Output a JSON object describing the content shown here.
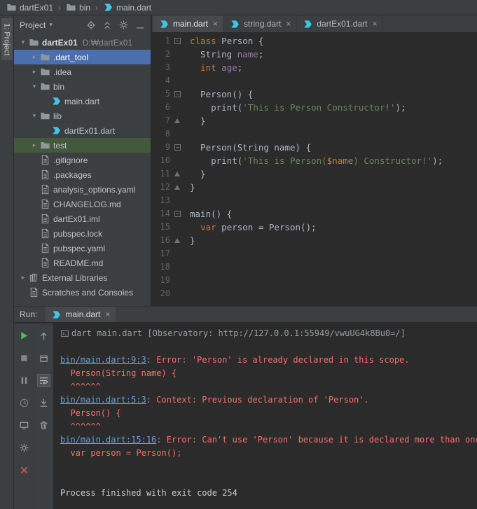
{
  "colors": {
    "background": "#2b2b2b",
    "panel": "#3c3f41",
    "selection_blue": "#4b6eaf",
    "test_row_green": "#44583c",
    "keyword_orange": "#cc7832",
    "string_green": "#6a8759",
    "field_purple": "#9876aa",
    "error_red": "#ff6b68",
    "link_blue": "#6a9fd8",
    "run_green": "#4ebe51",
    "close_red": "#c75450",
    "dart_teal": "#40c4e6"
  },
  "breadcrumb_bar": {
    "items": [
      {
        "label": "dartEx01",
        "glyph": "folder"
      },
      {
        "label": "bin",
        "glyph": "folder"
      },
      {
        "label": "main.dart",
        "glyph": "dart"
      }
    ]
  },
  "tool_strip": {
    "project_button_label": "1: Project"
  },
  "project_panel": {
    "title": "Project",
    "toolbar_icons": [
      {
        "id": "locate-file-icon",
        "glyph": "locate"
      },
      {
        "id": "collapse-all-icon",
        "glyph": "collapse"
      },
      {
        "id": "settings-gear-icon",
        "glyph": "gear"
      },
      {
        "id": "hide-panel-icon",
        "glyph": "hide"
      }
    ],
    "tree": [
      {
        "label": "dartEx01",
        "path": "D:₩dartEx01",
        "level": 0,
        "glyph": "folder",
        "chevron": "expanded",
        "bold": true
      },
      {
        "label": ".dart_tool",
        "level": 1,
        "glyph": "folder",
        "chevron": "collapsed",
        "selected": true
      },
      {
        "label": ".idea",
        "level": 1,
        "glyph": "folder",
        "chevron": "collapsed"
      },
      {
        "label": "bin",
        "level": 1,
        "glyph": "folder",
        "chevron": "expanded"
      },
      {
        "label": "main.dart",
        "level": 2,
        "glyph": "dart"
      },
      {
        "label": "lib",
        "level": 1,
        "glyph": "folder",
        "chevron": "expanded"
      },
      {
        "label": "dartEx01.dart",
        "level": 2,
        "glyph": "dart"
      },
      {
        "label": "test",
        "level": 1,
        "glyph": "folder",
        "chevron": "collapsed",
        "highlight": "test"
      },
      {
        "label": ".gitignore",
        "level": 1,
        "glyph": "file"
      },
      {
        "label": ".packages",
        "level": 1,
        "glyph": "file"
      },
      {
        "label": "analysis_options.yaml",
        "level": 1,
        "glyph": "file"
      },
      {
        "label": "CHANGELOG.md",
        "level": 1,
        "glyph": "file"
      },
      {
        "label": "dartEx01.iml",
        "level": 1,
        "glyph": "file"
      },
      {
        "label": "pubspec.lock",
        "level": 1,
        "glyph": "file"
      },
      {
        "label": "pubspec.yaml",
        "level": 1,
        "glyph": "file"
      },
      {
        "label": "README.md",
        "level": 1,
        "glyph": "file"
      },
      {
        "label": "External Libraries",
        "level": 0,
        "glyph": "library",
        "chevron": "collapsed"
      },
      {
        "label": "Scratches and Consoles",
        "level": 0,
        "glyph": "scratch"
      }
    ]
  },
  "editor": {
    "tabs": [
      {
        "label": "main.dart",
        "selected": true
      },
      {
        "label": "string.dart",
        "selected": false
      },
      {
        "label": "dartEx01.dart",
        "selected": false
      }
    ],
    "line_count": 20,
    "folds": {
      "open": [
        1,
        5,
        9,
        14
      ],
      "close": [
        7,
        11,
        12,
        16
      ]
    },
    "lines": [
      [
        {
          "t": "class",
          "c": "kw"
        },
        {
          "t": " Person {",
          "c": "pl"
        }
      ],
      [
        {
          "t": "  String ",
          "c": "pl"
        },
        {
          "t": "name",
          "c": "fld"
        },
        {
          "t": ";",
          "c": "pl"
        }
      ],
      [
        {
          "t": "  ",
          "c": "pl"
        },
        {
          "t": "int",
          "c": "kw"
        },
        {
          "t": " ",
          "c": "pl"
        },
        {
          "t": "age",
          "c": "fld"
        },
        {
          "t": ";",
          "c": "pl"
        }
      ],
      [],
      [
        {
          "t": "  Person() {",
          "c": "pl"
        }
      ],
      [
        {
          "t": "    print(",
          "c": "pl"
        },
        {
          "t": "'This is Person Constructor!'",
          "c": "str"
        },
        {
          "t": ");",
          "c": "pl"
        }
      ],
      [
        {
          "t": "  }",
          "c": "pl"
        }
      ],
      [],
      [
        {
          "t": "  Person(String name) {",
          "c": "pl"
        }
      ],
      [
        {
          "t": "    print(",
          "c": "pl"
        },
        {
          "t": "'This is Person(",
          "c": "str"
        },
        {
          "t": "$name",
          "c": "interp"
        },
        {
          "t": ") Constructor!'",
          "c": "str"
        },
        {
          "t": ");",
          "c": "pl"
        }
      ],
      [
        {
          "t": "  }",
          "c": "pl"
        }
      ],
      [
        {
          "t": "}",
          "c": "pl"
        }
      ],
      [],
      [
        {
          "t": "main() {",
          "c": "pl"
        }
      ],
      [
        {
          "t": "  ",
          "c": "pl"
        },
        {
          "t": "var",
          "c": "kw"
        },
        {
          "t": " person = Person();",
          "c": "pl"
        }
      ],
      [
        {
          "t": "}",
          "c": "pl"
        }
      ],
      [],
      [],
      [],
      []
    ]
  },
  "run_panel": {
    "label": "Run:",
    "tab": {
      "label": "main.dart"
    },
    "toolbar_left": [
      {
        "id": "rerun-icon",
        "glyph": "play"
      },
      {
        "id": "stop-icon",
        "glyph": "stop"
      },
      {
        "id": "pause-output-icon",
        "glyph": "pause"
      },
      {
        "id": "profiler-clock-icon",
        "glyph": "clock"
      },
      {
        "id": "screen-icon",
        "glyph": "screen"
      },
      {
        "id": "settings-gear-icon",
        "glyph": "gear"
      },
      {
        "id": "close-icon",
        "glyph": "close-red"
      }
    ],
    "toolbar_console": [
      {
        "id": "up-stack-trace-icon",
        "glyph": "arrow-up"
      },
      {
        "id": "restore-layout-icon",
        "glyph": "restore"
      },
      {
        "id": "soft-wrap-icon",
        "glyph": "softwrap",
        "selected": true
      },
      {
        "id": "scroll-to-end-icon",
        "glyph": "scrollend"
      },
      {
        "id": "clear-all-icon",
        "glyph": "trash"
      }
    ],
    "console": [
      {
        "icon": true,
        "segs": [
          {
            "t": "dart main.dart [Observatory: http://127.0.0.1:55949/vwuUG4k8Bu0=/]",
            "c": "dim"
          }
        ]
      },
      {
        "segs": []
      },
      {
        "segs": [
          {
            "t": "bin/main.dart:9:3",
            "c": "link"
          },
          {
            "t": ": Error: 'Person' is already declared in this scope.",
            "c": "err"
          }
        ]
      },
      {
        "segs": [
          {
            "t": "  Person(String name) {",
            "c": "err"
          }
        ]
      },
      {
        "segs": [
          {
            "t": "  ^^^^^^",
            "c": "err"
          }
        ]
      },
      {
        "segs": [
          {
            "t": "bin/main.dart:5:3",
            "c": "link"
          },
          {
            "t": ": Context: Previous declaration of 'Person'.",
            "c": "err"
          }
        ]
      },
      {
        "segs": [
          {
            "t": "  Person() {",
            "c": "err"
          }
        ]
      },
      {
        "segs": [
          {
            "t": "  ^^^^^^",
            "c": "err"
          }
        ]
      },
      {
        "segs": [
          {
            "t": "bin/main.dart:15:16",
            "c": "link"
          },
          {
            "t": ": Error: Can't use 'Person' because it is declared more than once.",
            "c": "err"
          }
        ]
      },
      {
        "segs": [
          {
            "t": "  var person = Person();",
            "c": "err"
          }
        ]
      },
      {
        "segs": []
      },
      {
        "segs": []
      },
      {
        "segs": [
          {
            "t": "Process finished with exit code 254",
            "c": "pl"
          }
        ]
      }
    ]
  }
}
